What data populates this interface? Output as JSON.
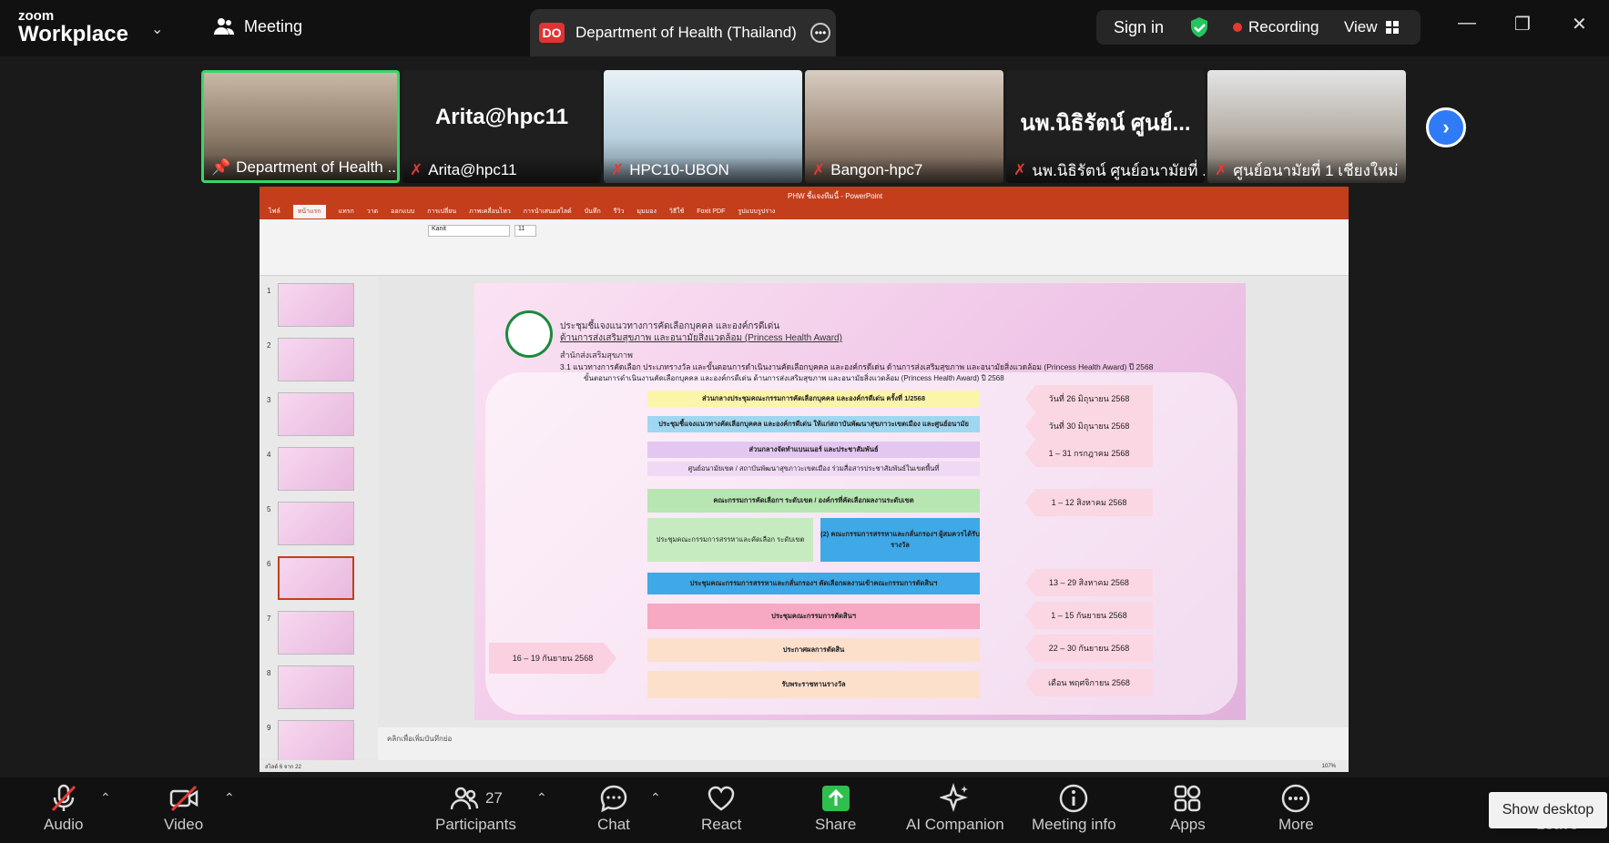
{
  "app": {
    "brand_top": "zoom",
    "brand_main": "Workplace"
  },
  "topbar": {
    "meeting_label": "Meeting",
    "share_tab": {
      "badge": "DO",
      "title": "Department of Health (Thailand) I"
    },
    "sign_in": "Sign in",
    "recording": "Recording",
    "view": "View"
  },
  "participants": [
    {
      "name": "Department of Health ...",
      "big": "",
      "pinned": true,
      "muted": false
    },
    {
      "name": "Arita@hpc11",
      "big": "Arita@hpc11",
      "pinned": false,
      "muted": true
    },
    {
      "name": "HPC10-UBON",
      "big": "",
      "pinned": false,
      "muted": true
    },
    {
      "name": "Bangon-hpc7",
      "big": "",
      "pinned": false,
      "muted": true
    },
    {
      "name": "นพ.นิธิรัตน์ ศูนย์อนามัยที่ ...",
      "big": "นพ.นิธิรัตน์ ศูนย์...",
      "pinned": false,
      "muted": true
    },
    {
      "name": "ศูนย์อนามัยที่ 1 เชียงใหม่",
      "big": "",
      "pinned": false,
      "muted": true
    }
  ],
  "ppt": {
    "window_title": "PHW ชี้แจงทีมนี้ - PowerPoint",
    "tabs": [
      "ไฟล์",
      "หน้าแรก",
      "แทรก",
      "วาด",
      "ออกแบบ",
      "การเปลี่ยน",
      "ภาพเคลื่อนไหว",
      "การนำเสนอสไลด์",
      "บันทึก",
      "รีวิว",
      "มุมมอง",
      "วิธีใช้",
      "Foxit PDF",
      "รูปแบบรูปร่าง"
    ],
    "font_name": "Kanit",
    "font_size": "11",
    "slide_numbers": [
      "1",
      "2",
      "3",
      "4",
      "5",
      "6",
      "7",
      "8",
      "9"
    ],
    "selected_slide": "6",
    "notes_placeholder": "คลิกเพื่อเพิ่มบันทึกย่อ",
    "status": "สไลด์ 6 จาก 22",
    "zoom": "107%"
  },
  "slide": {
    "title1": "ประชุมชี้แจงแนวทางการคัดเลือกบุคคล และองค์กรดีเด่น",
    "title2": "ด้านการส่งเสริมสุขภาพ และอนามัยสิ่งแวดล้อม (Princess Health Award)",
    "subtitle": "สำนักส่งเสริมสุขภาพ",
    "line": "3.1 แนวทางการคัดเลือก ประเภทรางวัล และขั้นตอนการดำเนินงานคัดเลือกบุคคล และองค์กรดีเด่น ด้านการส่งเสริมสุขภาพ และอนามัยสิ่งแวดล้อม (Princess Health Award) ปี 2568",
    "bullet": "ขั้นตอนการดำเนินงานคัดเลือกบุคคล และองค์กรดีเด่น ด้านการส่งเสริมสุขภาพ และอนามัยสิ่งแวดล้อม (Princess Health Award) ปี 2568",
    "steps": [
      "ส่วนกลางประชุมคณะกรรมการคัดเลือกบุคคล และองค์กรดีเด่น ครั้งที่ 1/2568",
      "ประชุมชี้แจงแนวทางคัดเลือกบุคคล และองค์กรดีเด่น ให้แก่สถาบันพัฒนาสุขภาวะเขตเมือง และศูนย์อนามัย",
      "ส่วนกลางจัดทำแบนเนอร์ และประชาสัมพันธ์",
      "ศูนย์อนามัยเขต / สถาบันพัฒนาสุขภาวะเขตเมือง ร่วมสื่อสารประชาสัมพันธ์ในเขตพื้นที่",
      "คณะกรรมการคัดเลือกฯ ระดับเขต / องค์กรที่คัดเลือกผลงานระดับเขต",
      "ประชุมคณะกรรมการสรรหาและคัดเลือก ระดับเขต",
      "(2) คณะกรรมการสรรหาและกลั่นกรองฯ ผู้สมควรได้รับรางวัล",
      "ประชุมคณะกรรมการสรรหาและกลั่นกรองฯ คัดเลือกผลงานเข้าคณะกรรมการตัดสินฯ",
      "ประชุมคณะกรรมการตัดสินฯ",
      "ประกาศผลการตัดสิน",
      "รับพระราชทานรางวัล"
    ],
    "dates": [
      "วันที่ 26 มิถุนายน 2568",
      "วันที่ 30 มิถุนายน 2568",
      "1 – 31 กรกฎาคม 2568",
      "1 – 12 สิงหาคม 2568",
      "13 – 29 สิงหาคม 2568",
      "1 – 15 กันยายน 2568",
      "22 – 30 กันยายน 2568",
      "เดือน พฤศจิกายน 2568"
    ],
    "left_date": "16 – 19 กันยายน 2568"
  },
  "toolbar": {
    "audio": "Audio",
    "video": "Video",
    "participants": "Participants",
    "participant_count": "27",
    "chat": "Chat",
    "react": "React",
    "share": "Share",
    "ai_companion": "AI Companion",
    "meeting_info": "Meeting info",
    "apps": "Apps",
    "more": "More",
    "leave": "Leave"
  },
  "tooltip": "Show desktop",
  "colors": {
    "accent_blue": "#2f7bf5",
    "share_green": "#2fbf4f",
    "active_border": "#38d66a",
    "record_red": "#e53935",
    "ppt_red": "#c43e1c"
  }
}
